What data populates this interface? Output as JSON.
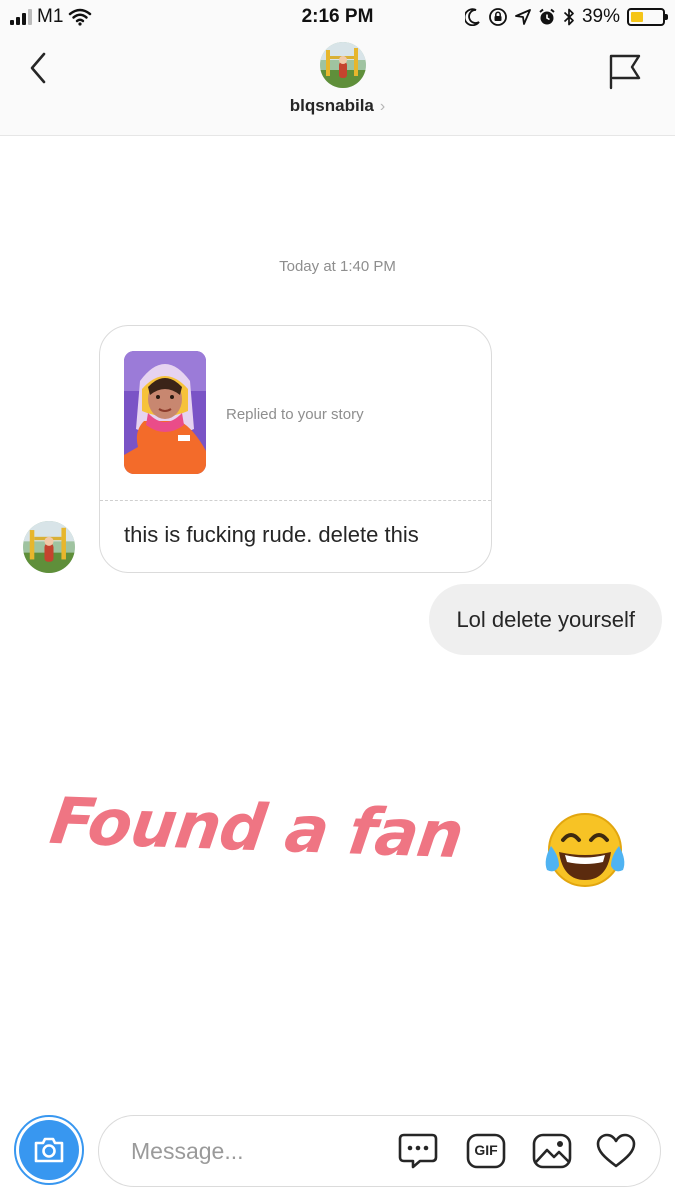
{
  "status_bar": {
    "carrier": "M1",
    "time": "2:16 PM",
    "battery_percent": "39%",
    "battery_level": 0.39,
    "battery_color": "#f5c518",
    "icons": [
      "signal-icon",
      "wifi-icon",
      "moon-icon",
      "orientation-lock-icon",
      "location-icon",
      "alarm-icon",
      "bluetooth-icon",
      "battery-icon"
    ]
  },
  "header": {
    "username": "blqsnabila",
    "chevron": "›",
    "back_icon": "chevron-left-icon",
    "flag_icon": "flag-icon"
  },
  "conversation": {
    "timestamp": "Today at 1:40 PM",
    "story_reply": {
      "label": "Replied to your story",
      "text": "this is fucking rude. delete this"
    },
    "outgoing_message": "Lol delete yourself"
  },
  "overlay": {
    "caption": "Found a fan",
    "caption_color": "#ef7583",
    "emoji": "tears-of-joy-emoji"
  },
  "composer": {
    "placeholder": "Message...",
    "gif_label": "GIF",
    "accent_color": "#3897f0",
    "tools": [
      "chat-bubble-icon",
      "gif-icon",
      "image-icon",
      "heart-icon"
    ]
  }
}
